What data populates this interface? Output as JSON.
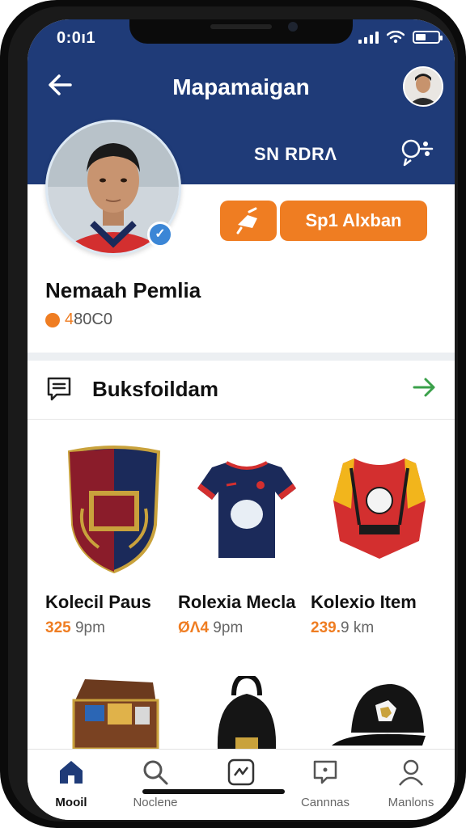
{
  "status": {
    "time": "0:0ı1"
  },
  "header": {
    "title": "Mapamaigan",
    "sub_label": "SN RDRΛ"
  },
  "profile": {
    "name": "Nemaah Pemlia",
    "points_prefix": "4",
    "points_rest": "80C0",
    "action_button": "Sp1 Alxban"
  },
  "section": {
    "title": "Buksfoildam"
  },
  "items": [
    {
      "name": "Kolecil Paus",
      "price_hl": "325",
      "price_rest": " 9pm",
      "icon": "crest-icon"
    },
    {
      "name": "Rolexia Mecla",
      "price_hl": "ØΛ4",
      "price_rest": " 9pm",
      "icon": "jersey-icon"
    },
    {
      "name": "Kolexio Item",
      "price_hl": "239.",
      "price_rest": "9 km",
      "icon": "vest-icon"
    },
    {
      "name": "",
      "icon": "chest-icon"
    },
    {
      "name": "",
      "icon": "backpack-icon"
    },
    {
      "name": "",
      "icon": "cap-icon"
    }
  ],
  "nav": [
    {
      "label": "Mooil",
      "icon": "home-icon",
      "active": true
    },
    {
      "label": "Noclene",
      "icon": "search-icon",
      "active": false
    },
    {
      "label": "",
      "icon": "game-icon",
      "active": false
    },
    {
      "label": "Cannnas",
      "icon": "chat-icon",
      "active": false
    },
    {
      "label": "Manlons",
      "icon": "user-icon",
      "active": false
    }
  ],
  "colors": {
    "header": "#1f3b78",
    "accent": "#ef7d22",
    "verified": "#3b86d6",
    "arrow": "#3aa04a"
  }
}
